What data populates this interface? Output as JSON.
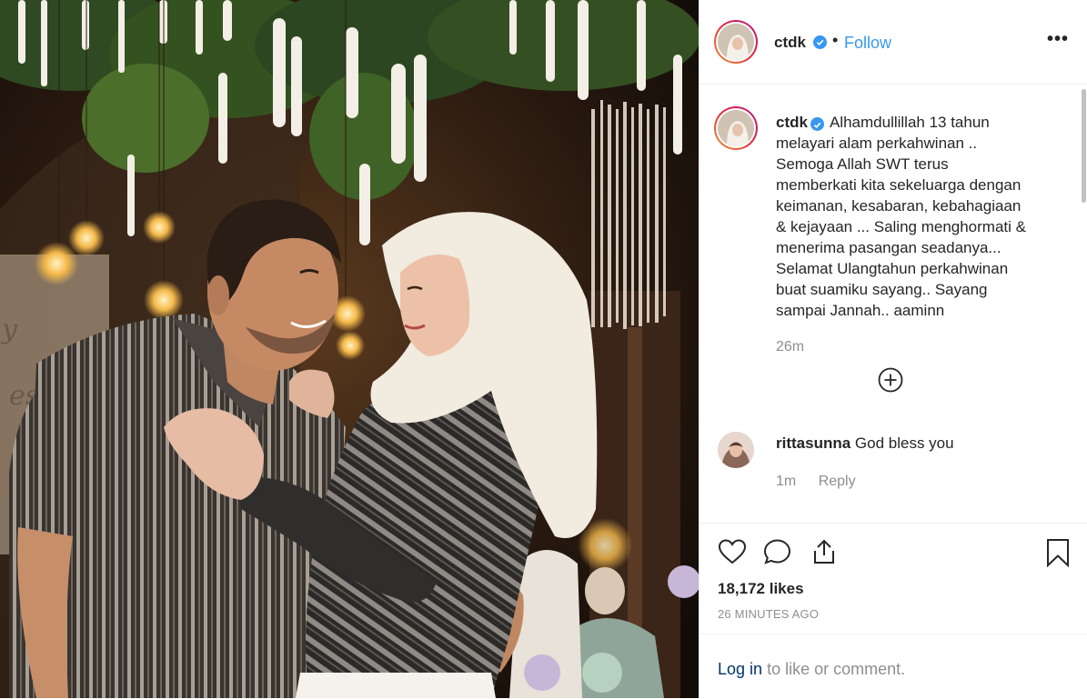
{
  "post": {
    "username": "ctdk",
    "follow_label": "Follow",
    "more_label": "•••",
    "caption_lines": [
      "Alhamdullillah 13 tahun",
      "melayari alam perkahwinan ..",
      "Semoga Allah SWT terus",
      "memberkati kita sekeluarga dengan",
      "keimanan, kesabaran, kebahagiaan",
      "& kejayaan ... Saling menghormati &",
      "menerima pasangan seadanya...",
      "Selamat Ulangtahun perkahwinan",
      "buat suamiku sayang.. Sayang",
      "sampai Jannah.. aaminn"
    ],
    "caption_time": "26m",
    "likes": "18,172 likes",
    "posted_ago": "26 MINUTES AGO"
  },
  "comment": {
    "username": "rittasunna",
    "text": "God bless you",
    "time": "1m",
    "reply_label": "Reply"
  },
  "login": {
    "link_label": "Log in",
    "rest_label": "to like or comment."
  },
  "icons": {
    "verified": "verified-badge-icon",
    "add": "plus-circle-icon",
    "like": "heart-icon",
    "comment": "comment-bubble-icon",
    "share": "share-icon",
    "save": "bookmark-icon"
  },
  "colors": {
    "accent": "#3897f0",
    "secondary_text": "#8e8e8e",
    "primary_text": "#262626",
    "border": "#efefef"
  }
}
